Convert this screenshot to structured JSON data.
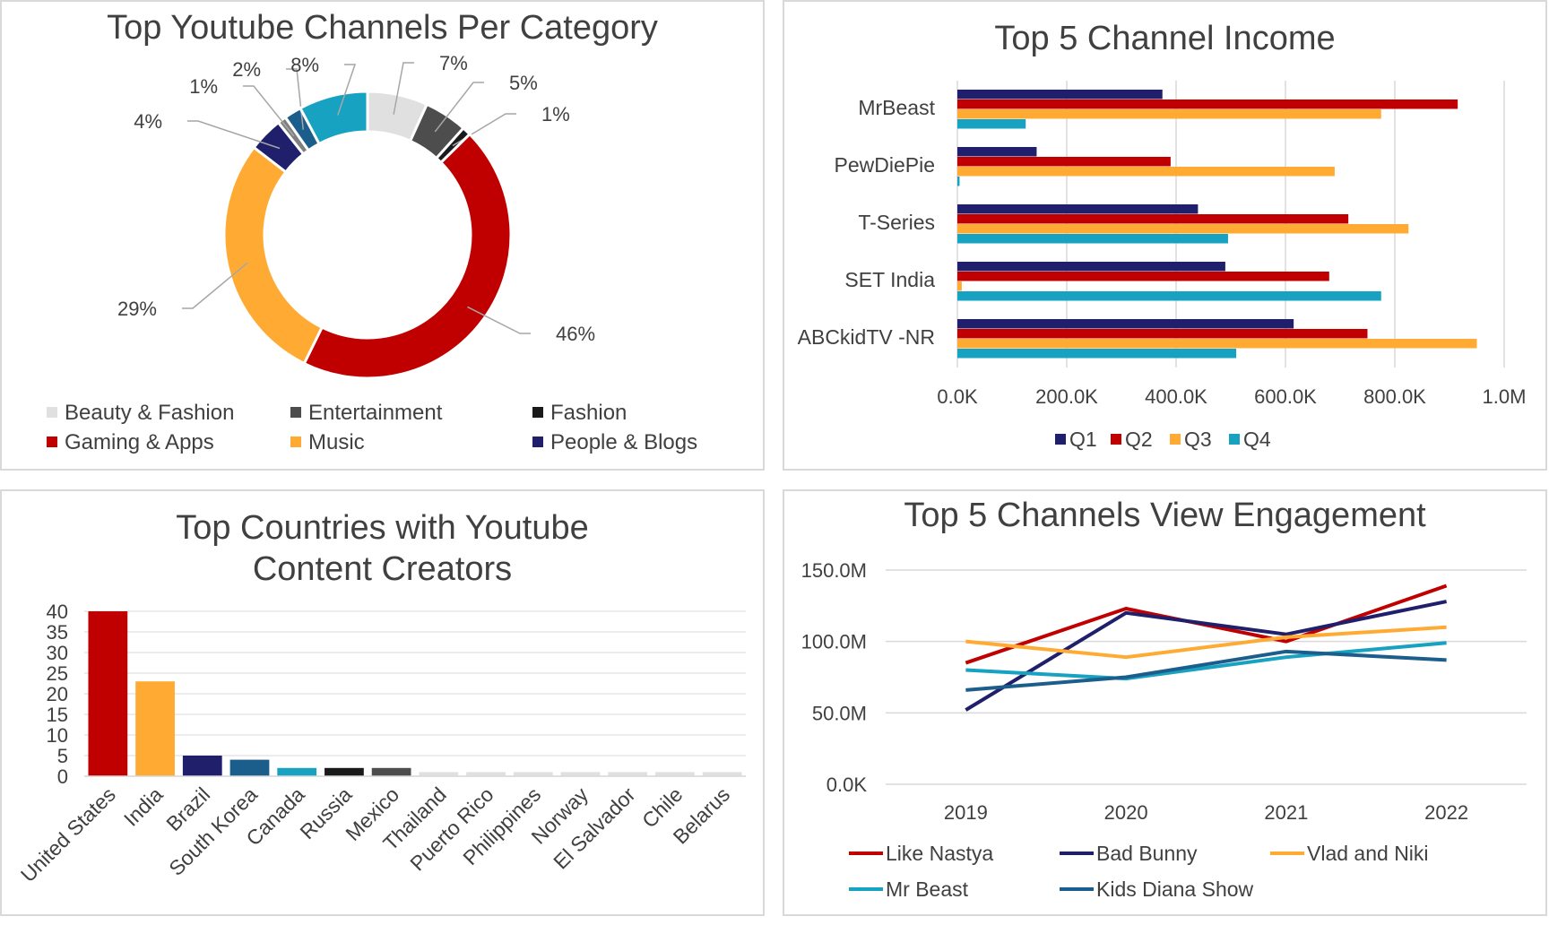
{
  "chart_data": [
    {
      "type": "pie",
      "variant": "doughnut",
      "title": "Top Youtube Channels Per Category",
      "slices": [
        {
          "label": "Beauty & Fashion",
          "value": 7,
          "display": "7%",
          "color": "#e0e0e0"
        },
        {
          "label": "Entertainment",
          "value": 5,
          "display": "5%",
          "color": "#4d4d4d"
        },
        {
          "label": "Fashion",
          "value": 1,
          "display": "1%",
          "color": "#1a1a1a"
        },
        {
          "label": "Gaming & Apps",
          "value": 46,
          "display": "46%",
          "color": "#c00000"
        },
        {
          "label": "Music",
          "value": 29,
          "display": "29%",
          "color": "#ffab33"
        },
        {
          "label": "People & Blogs",
          "value": 4,
          "display": "4%",
          "color": "#1f1f6b"
        },
        {
          "label": "",
          "value": 1,
          "display": "1%",
          "color": "#7f7f7f"
        },
        {
          "label": "",
          "value": 2,
          "display": "2%",
          "color": "#1b5e8c"
        },
        {
          "label": "",
          "value": 8,
          "display": "8%",
          "color": "#17a2c2"
        }
      ],
      "legend": [
        "Beauty & Fashion",
        "Entertainment",
        "Fashion",
        "Gaming & Apps",
        "Music",
        "People & Blogs"
      ],
      "legend_position": "bottom"
    },
    {
      "type": "bar",
      "orientation": "horizontal",
      "title": "Top 5 Channel Income",
      "categories": [
        "MrBeast",
        "PewDiePie",
        "T-Series",
        "SET India",
        "ABCkidTV -NR"
      ],
      "series": [
        {
          "name": "Q1",
          "color": "#1f1f6b",
          "values": [
            375000,
            145000,
            440000,
            490000,
            615000
          ]
        },
        {
          "name": "Q2",
          "color": "#c00000",
          "values": [
            915000,
            390000,
            715000,
            680000,
            750000
          ]
        },
        {
          "name": "Q3",
          "color": "#ffab33",
          "values": [
            775000,
            690000,
            825000,
            8000,
            950000
          ]
        },
        {
          "name": "Q4",
          "color": "#17a2c2",
          "values": [
            125000,
            4000,
            495000,
            775000,
            510000
          ]
        }
      ],
      "xlim": [
        0,
        1000000
      ],
      "xticks": [
        "0.0K",
        "200.0K",
        "400.0K",
        "600.0K",
        "800.0K",
        "1.0M"
      ],
      "grid": true,
      "legend_position": "bottom"
    },
    {
      "type": "bar",
      "title": "Top Countries with Youtube\nContent Creators",
      "categories": [
        "United States",
        "India",
        "Brazil",
        "South Korea",
        "Canada",
        "Russia",
        "Mexico",
        "Thailand",
        "Puerto Rico",
        "Philippines",
        "Norway",
        "El Salvador",
        "Chile",
        "Belarus"
      ],
      "values": [
        40,
        23,
        5,
        4,
        2,
        2,
        2,
        1,
        1,
        1,
        1,
        1,
        1,
        1
      ],
      "colors": [
        "#c00000",
        "#ffab33",
        "#1f1f6b",
        "#1b5e8c",
        "#17a2c2",
        "#1a1a1a",
        "#4d4d4d",
        "#e0e0e0",
        "#e0e0e0",
        "#e0e0e0",
        "#e0e0e0",
        "#e0e0e0",
        "#e0e0e0",
        "#e0e0e0"
      ],
      "ylim": [
        0,
        40
      ],
      "yticks": [
        "0",
        "5",
        "10",
        "15",
        "20",
        "25",
        "30",
        "35",
        "40"
      ],
      "grid": true
    },
    {
      "type": "line",
      "title": "Top 5 Channels View Engagement",
      "x": [
        "2019",
        "2020",
        "2021",
        "2022"
      ],
      "series": [
        {
          "name": "Like Nastya",
          "color": "#c00000",
          "values": [
            85000000,
            123000000,
            100000000,
            139000000
          ]
        },
        {
          "name": "Bad Bunny",
          "color": "#1f1f6b",
          "values": [
            52000000,
            120000000,
            105000000,
            128000000
          ]
        },
        {
          "name": "Vlad and Niki",
          "color": "#ffab33",
          "values": [
            100000000,
            89000000,
            103000000,
            110000000
          ]
        },
        {
          "name": "Mr Beast",
          "color": "#17a2c2",
          "values": [
            80000000,
            74000000,
            89000000,
            99000000
          ]
        },
        {
          "name": "Kids Diana Show",
          "color": "#1b5e8c",
          "values": [
            66000000,
            75000000,
            93000000,
            87000000
          ]
        }
      ],
      "ylim": [
        0,
        150000000
      ],
      "yticks": [
        "0.0K",
        "50.0M",
        "100.0M",
        "150.0M"
      ],
      "grid": true,
      "legend_position": "bottom"
    }
  ]
}
